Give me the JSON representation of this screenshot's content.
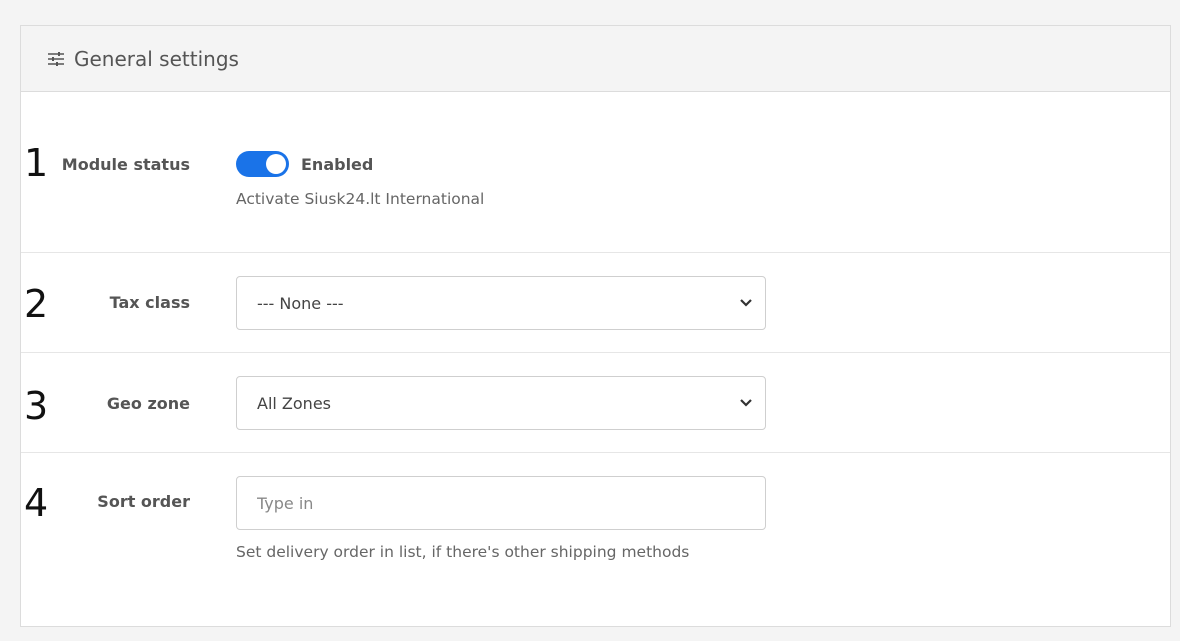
{
  "panel": {
    "title": "General settings",
    "title_icon": "sliders-icon"
  },
  "rows": [
    {
      "number": "1",
      "label": "Module status",
      "toggle": {
        "state": "Enabled",
        "on": true,
        "color": "#1a73e8"
      },
      "help": "Activate Siusk24.lt International"
    },
    {
      "number": "2",
      "label": "Tax class",
      "select": {
        "value": "--- None ---"
      }
    },
    {
      "number": "3",
      "label": "Geo zone",
      "select": {
        "value": "All Zones"
      }
    },
    {
      "number": "4",
      "label": "Sort order",
      "input": {
        "value": "",
        "placeholder": "Type in"
      },
      "help": "Set delivery order in list, if there's other shipping methods"
    }
  ]
}
